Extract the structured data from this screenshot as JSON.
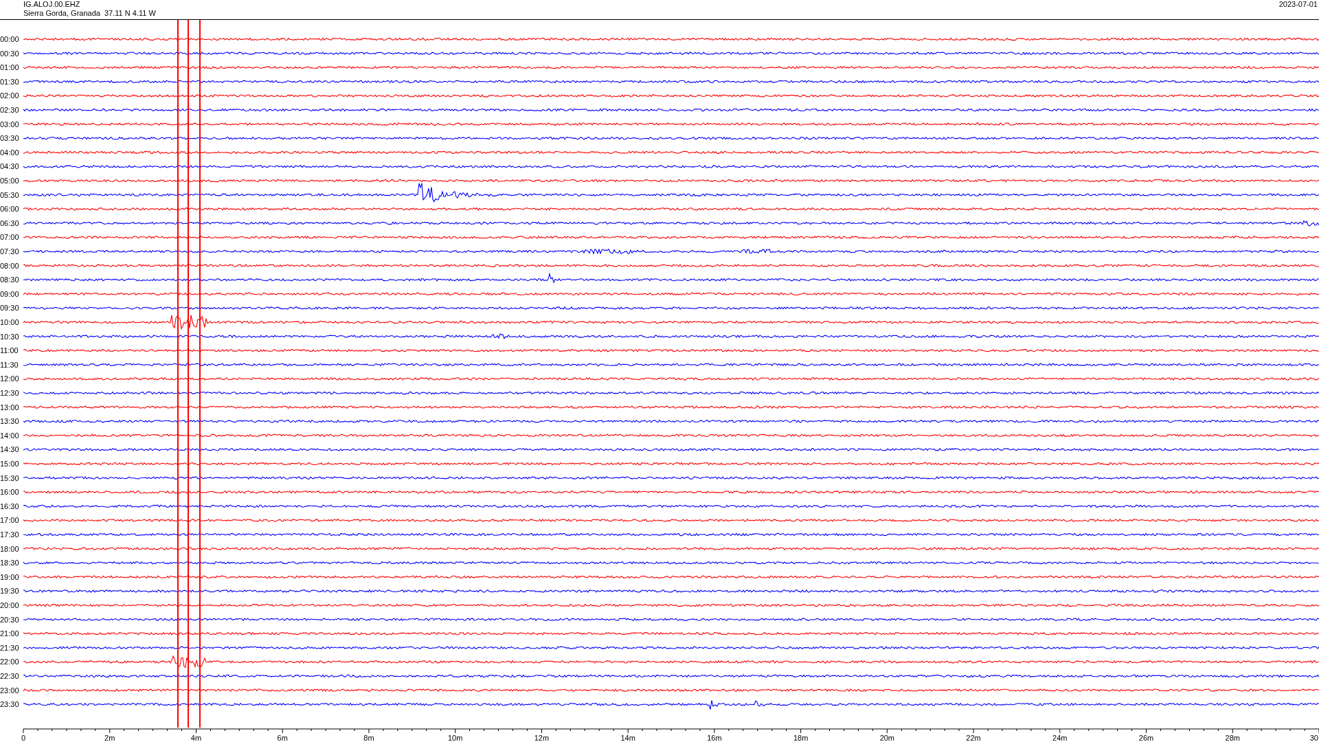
{
  "header": {
    "station": "IG.ALOJ.00.EHZ",
    "location": "Sierra Gorda, Granada  37.11 N 4.11 W",
    "date": "2023-07-01"
  },
  "traces": [
    {
      "time": "00:00",
      "color": "#ff0000"
    },
    {
      "time": "00:30",
      "color": "#0000ff"
    },
    {
      "time": "01:00",
      "color": "#ff0000"
    },
    {
      "time": "01:30",
      "color": "#0000ff"
    },
    {
      "time": "02:00",
      "color": "#ff0000"
    },
    {
      "time": "02:30",
      "color": "#0000ff"
    },
    {
      "time": "03:00",
      "color": "#ff0000"
    },
    {
      "time": "03:30",
      "color": "#0000ff"
    },
    {
      "time": "04:00",
      "color": "#ff0000"
    },
    {
      "time": "04:30",
      "color": "#0000ff"
    },
    {
      "time": "05:00",
      "color": "#ff0000"
    },
    {
      "time": "05:30",
      "color": "#0000ff"
    },
    {
      "time": "06:00",
      "color": "#ff0000"
    },
    {
      "time": "06:30",
      "color": "#0000ff"
    },
    {
      "time": "07:00",
      "color": "#ff0000"
    },
    {
      "time": "07:30",
      "color": "#0000ff"
    },
    {
      "time": "08:00",
      "color": "#ff0000"
    },
    {
      "time": "08:30",
      "color": "#0000ff"
    },
    {
      "time": "09:00",
      "color": "#ff0000"
    },
    {
      "time": "09:30",
      "color": "#0000ff"
    },
    {
      "time": "10:00",
      "color": "#ff0000"
    },
    {
      "time": "10:30",
      "color": "#0000ff"
    },
    {
      "time": "11:00",
      "color": "#ff0000"
    },
    {
      "time": "11:30",
      "color": "#0000ff"
    },
    {
      "time": "12:00",
      "color": "#ff0000"
    },
    {
      "time": "12:30",
      "color": "#0000ff"
    },
    {
      "time": "13:00",
      "color": "#ff0000"
    },
    {
      "time": "13:30",
      "color": "#0000ff"
    },
    {
      "time": "14:00",
      "color": "#ff0000"
    },
    {
      "time": "14:30",
      "color": "#0000ff"
    },
    {
      "time": "15:00",
      "color": "#ff0000"
    },
    {
      "time": "15:30",
      "color": "#0000ff"
    },
    {
      "time": "16:00",
      "color": "#ff0000"
    },
    {
      "time": "16:30",
      "color": "#0000ff"
    },
    {
      "time": "17:00",
      "color": "#ff0000"
    },
    {
      "time": "17:30",
      "color": "#0000ff"
    },
    {
      "time": "18:00",
      "color": "#ff0000"
    },
    {
      "time": "18:30",
      "color": "#0000ff"
    },
    {
      "time": "19:00",
      "color": "#ff0000"
    },
    {
      "time": "19:30",
      "color": "#0000ff"
    },
    {
      "time": "20:00",
      "color": "#ff0000"
    },
    {
      "time": "20:30",
      "color": "#0000ff"
    },
    {
      "time": "21:00",
      "color": "#ff0000"
    },
    {
      "time": "21:30",
      "color": "#0000ff"
    },
    {
      "time": "22:00",
      "color": "#ff0000"
    },
    {
      "time": "22:30",
      "color": "#0000ff"
    },
    {
      "time": "23:00",
      "color": "#ff0000"
    },
    {
      "time": "23:30",
      "color": "#0000ff"
    }
  ],
  "axis": {
    "ticks": [
      "0",
      "2m",
      "4m",
      "6m",
      "8m",
      "10m",
      "12m",
      "14m",
      "16m",
      "18m",
      "20m",
      "22m",
      "24m",
      "26m",
      "28m",
      "30"
    ]
  }
}
